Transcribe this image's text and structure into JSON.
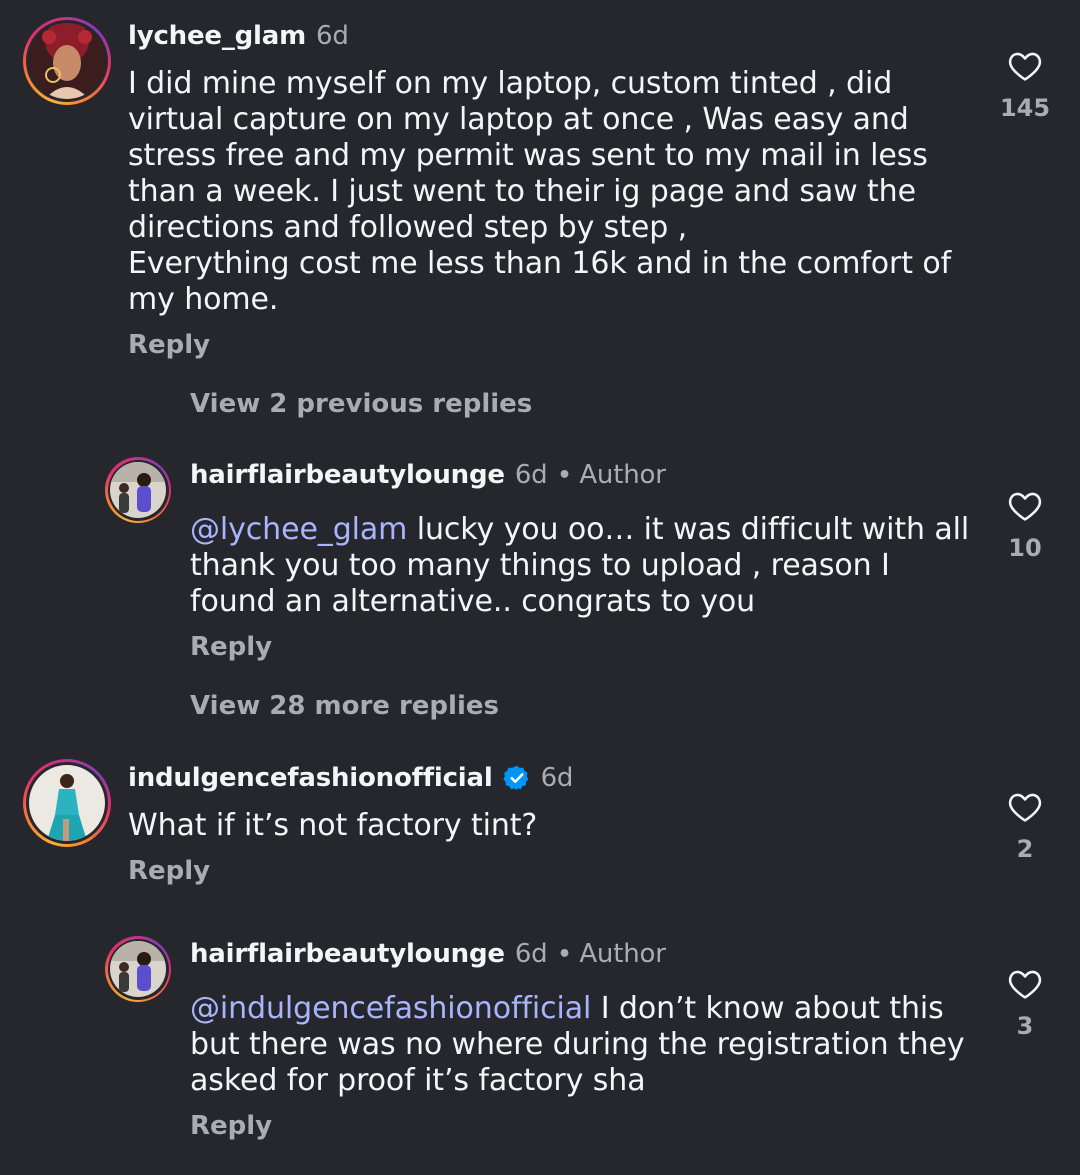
{
  "comments": [
    {
      "username": "lychee_glam",
      "time": "6d",
      "text": "I did mine myself on my laptop, custom tinted , did virtual capture on my laptop at once , Was easy and stress free and my permit was sent to my mail in less than a week. I just went to their ig page and saw the directions and followed step by step ,\nEverything cost me less than 16k and in the comfort of my home.",
      "reply_label": "Reply",
      "likes": "145"
    },
    {
      "view_prev_label": "View 2 previous replies"
    },
    {
      "username": "hairflairbeautylounge",
      "time": "6d",
      "dot": "•",
      "author_label": "Author",
      "mention": "@lychee_glam",
      "text": " lucky you oo… it was difficult with all thank you too many things to upload , reason I found an alternative.. congrats to you",
      "reply_label": "Reply",
      "likes": "10"
    },
    {
      "view_more_label": "View 28 more replies"
    },
    {
      "username": "indulgencefashionofficial",
      "time": "6d",
      "text": "What if it’s not factory tint?",
      "reply_label": "Reply",
      "likes": "2"
    },
    {
      "username": "hairflairbeautylounge",
      "time": "6d",
      "dot": "•",
      "author_label": "Author",
      "mention": "@indulgencefashionofficial",
      "text": " I don’t know about this but there was no where during the registration they asked for proof it’s factory sha",
      "reply_label": "Reply",
      "likes": "3"
    }
  ],
  "colors": {
    "background": "#25272c",
    "text": "#f3f5f7",
    "muted": "#a8acb3",
    "mention": "#a9b4ff",
    "verified": "#0095f6"
  },
  "icons": [
    "heart-outline-icon",
    "verified-badge-icon"
  ]
}
